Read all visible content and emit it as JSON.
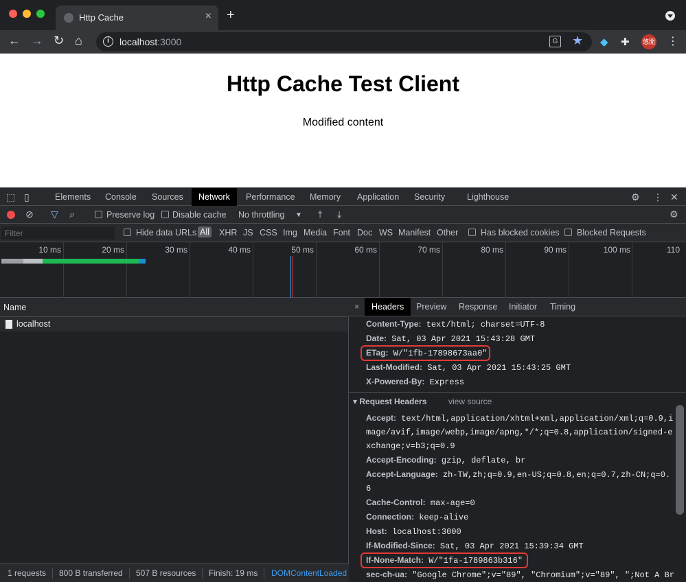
{
  "browser": {
    "tab_title": "Http Cache",
    "new_tab": "+",
    "url_host": "localhost",
    "url_port": ":3000",
    "avatar_text": "悠閒",
    "translate_icon": "translate-icon",
    "star_icon": "star-icon",
    "colors": {
      "star": "#8ab4f8",
      "avatar": "#c5372c"
    }
  },
  "page": {
    "heading": "Http Cache Test Client",
    "content": "Modified content"
  },
  "devtools": {
    "tabs": [
      "Elements",
      "Console",
      "Sources",
      "Network",
      "Performance",
      "Memory",
      "Application",
      "Security",
      "Lighthouse"
    ],
    "active_tab": "Network",
    "toolbar": {
      "preserve_log": "Preserve log",
      "disable_cache": "Disable cache",
      "throttling": "No throttling"
    },
    "filter": {
      "placeholder": "Filter",
      "hide_data_urls": "Hide data URLs",
      "types": [
        "All",
        "XHR",
        "JS",
        "CSS",
        "Img",
        "Media",
        "Font",
        "Doc",
        "WS",
        "Manifest",
        "Other"
      ],
      "has_blocked_cookies": "Has blocked cookies",
      "blocked_requests": "Blocked Requests"
    },
    "timeline_ticks": [
      "10 ms",
      "20 ms",
      "30 ms",
      "40 ms",
      "50 ms",
      "60 ms",
      "70 ms",
      "80 ms",
      "90 ms",
      "100 ms",
      "110"
    ],
    "name_column": "Name",
    "requests": [
      {
        "name": "localhost"
      }
    ],
    "status": {
      "requests": "1 requests",
      "transferred": "800 B transferred",
      "resources": "507 B resources",
      "finish": "Finish: 19 ms",
      "dcl": "DOMContentLoaded"
    },
    "detail_tabs": [
      "Headers",
      "Preview",
      "Response",
      "Initiator",
      "Timing"
    ],
    "active_detail_tab": "Headers",
    "response_headers": [
      {
        "key": "Content-Type:",
        "value": "text/html; charset=UTF-8"
      },
      {
        "key": "Date:",
        "value": "Sat, 03 Apr 2021 15:43:28 GMT"
      },
      {
        "key": "ETag:",
        "value": "W/\"1fb-17898673aa0\""
      },
      {
        "key": "Last-Modified:",
        "value": "Sat, 03 Apr 2021 15:43:25 GMT"
      },
      {
        "key": "X-Powered-By:",
        "value": "Express"
      }
    ],
    "request_headers_title": "▾ Request Headers",
    "view_source": "view source",
    "request_headers": [
      {
        "key": "Accept:",
        "value": "text/html,application/xhtml+xml,application/xml;q=0.9,i"
      },
      {
        "key": "",
        "value": "mage/avif,image/webp,image/apng,*/*;q=0.8,application/signed-e"
      },
      {
        "key": "",
        "value": "xchange;v=b3;q=0.9"
      },
      {
        "key": "Accept-Encoding:",
        "value": "gzip, deflate, br"
      },
      {
        "key": "Accept-Language:",
        "value": "zh-TW,zh;q=0.9,en-US;q=0.8,en;q=0.7,zh-CN;q=0."
      },
      {
        "key": "",
        "value": "6"
      },
      {
        "key": "Cache-Control:",
        "value": "max-age=0"
      },
      {
        "key": "Connection:",
        "value": "keep-alive"
      },
      {
        "key": "Host:",
        "value": "localhost:3000"
      },
      {
        "key": "If-Modified-Since:",
        "value": "Sat, 03 Apr 2021 15:39:34 GMT"
      },
      {
        "key": "If-None-Match:",
        "value": "W/\"1fa-1789863b316\""
      },
      {
        "key": "sec-ch-ua:",
        "value": "\"Google Chrome\";v=\"89\", \"Chromium\";v=\"89\", \";Not A Br"
      }
    ],
    "colors": {
      "highlight": "#e53935",
      "record": "#f14c4c",
      "dcl_link": "#3d9cf0"
    }
  }
}
